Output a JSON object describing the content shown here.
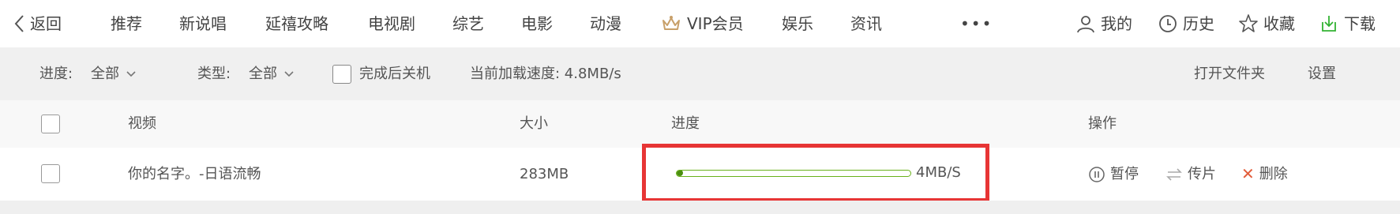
{
  "nav": {
    "back_label": "返回",
    "tabs": [
      "推荐",
      "新说唱",
      "延禧攻略",
      "电视剧",
      "综艺",
      "电影",
      "动漫"
    ],
    "vip_label": "VIP会员",
    "tabs2": [
      "娱乐",
      "资讯"
    ],
    "more_label": "•••",
    "mine_label": "我的",
    "history_label": "历史",
    "favorites_label": "收藏",
    "download_label": "下载"
  },
  "filters": {
    "progress_label": "进度:",
    "progress_value": "全部",
    "type_label": "类型:",
    "type_value": "全部",
    "shutdown_label": "完成后关机",
    "speed_label": "当前加载速度: 4.8MB/s",
    "open_folder_label": "打开文件夹",
    "settings_label": "设置"
  },
  "table": {
    "headers": {
      "video": "视频",
      "size": "大小",
      "progress": "进度",
      "actions": "操作"
    },
    "rows": [
      {
        "name": "你的名字。-日语流畅",
        "size": "283MB",
        "progress": 0.01,
        "speed": "4MB/S",
        "pause_label": "暂停",
        "transfer_label": "传片",
        "delete_label": "删除"
      }
    ]
  },
  "colors": {
    "accent_green": "#33b233",
    "progress_green": "#6ab11c",
    "vip_gold": "#c8a06a",
    "highlight_red": "#e73535"
  }
}
